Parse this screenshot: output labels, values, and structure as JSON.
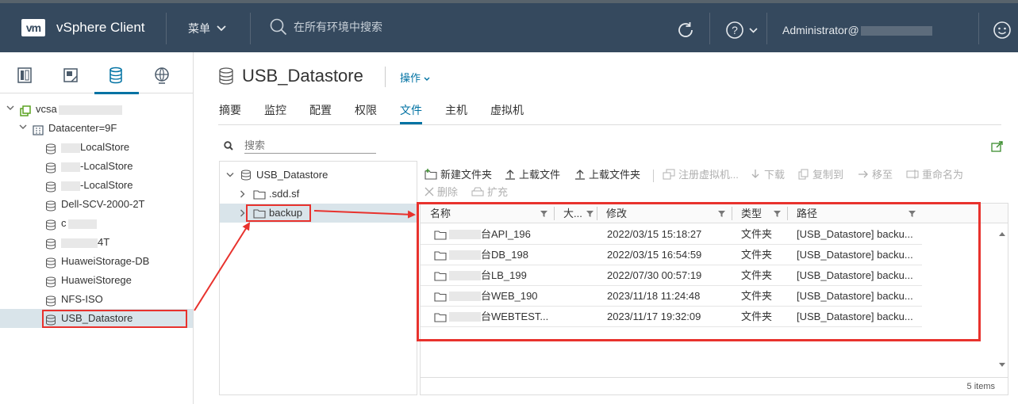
{
  "topbar": {
    "logo": "vm",
    "title": "vSphere Client",
    "menu_label": "菜单",
    "search_placeholder": "在所有环境中搜索",
    "user": "Administrator@"
  },
  "left": {
    "tree": [
      {
        "label": "vcsa",
        "level": 0,
        "icon": "vcenter-icon"
      },
      {
        "label": "Datacenter=9F",
        "level": 1,
        "icon": "datacenter-icon"
      },
      {
        "label": "LocalStore",
        "level": 2,
        "icon": "datastore-icon"
      },
      {
        "label": "-LocalStore",
        "level": 2,
        "icon": "datastore-icon"
      },
      {
        "label": "-LocalStore",
        "level": 2,
        "icon": "datastore-icon"
      },
      {
        "label": "Dell-SCV-2000-2T",
        "level": 2,
        "icon": "datastore-icon"
      },
      {
        "label": "c",
        "level": 2,
        "icon": "datastore-icon"
      },
      {
        "label": "4T",
        "level": 2,
        "icon": "datastore-icon"
      },
      {
        "label": "HuaweiStorage-DB",
        "level": 2,
        "icon": "datastore-icon"
      },
      {
        "label": "HuaweiStorege",
        "level": 2,
        "icon": "datastore-icon"
      },
      {
        "label": "NFS-ISO",
        "level": 2,
        "icon": "datastore-icon"
      },
      {
        "label": "USB_Datastore",
        "level": 2,
        "icon": "datastore-icon",
        "selected": true
      }
    ]
  },
  "main": {
    "title": "USB_Datastore",
    "actions_label": "操作",
    "tabs": [
      "摘要",
      "监控",
      "配置",
      "权限",
      "文件",
      "主机",
      "虚拟机"
    ],
    "active_tab": "文件",
    "search_label": "搜索",
    "folder_tree": [
      {
        "label": "USB_Datastore"
      },
      {
        "label": ".sdd.sf"
      },
      {
        "label": "backup",
        "selected": true
      }
    ],
    "toolbar": {
      "new_folder": "新建文件夹",
      "upload_file": "上载文件",
      "upload_folder": "上载文件夹",
      "register_vm": "注册虚拟机...",
      "download": "下载",
      "copy_to": "复制到",
      "move_to": "移至",
      "rename": "重命名为",
      "delete": "删除",
      "inflate": "扩充"
    },
    "columns": [
      "名称",
      "大...",
      "修改",
      "类型",
      "路径"
    ],
    "rows": [
      {
        "name": "台API_196",
        "modified": "2022/03/15 15:18:27",
        "type": "文件夹",
        "path": "[USB_Datastore] backu..."
      },
      {
        "name": "台DB_198",
        "modified": "2022/03/15 16:54:59",
        "type": "文件夹",
        "path": "[USB_Datastore] backu..."
      },
      {
        "name": "台LB_199",
        "modified": "2022/07/30 00:57:19",
        "type": "文件夹",
        "path": "[USB_Datastore] backu..."
      },
      {
        "name": "台WEB_190",
        "modified": "2023/11/18 11:24:48",
        "type": "文件夹",
        "path": "[USB_Datastore] backu..."
      },
      {
        "name": "台WEBTEST...",
        "modified": "2023/11/17 19:32:09",
        "type": "文件夹",
        "path": "[USB_Datastore] backu..."
      }
    ],
    "footer": "5 items"
  },
  "colors": {
    "header_bg": "#35495e",
    "accent": "#0072a3",
    "annotation_red": "#e8322d",
    "selection": "#d9e4ea"
  }
}
